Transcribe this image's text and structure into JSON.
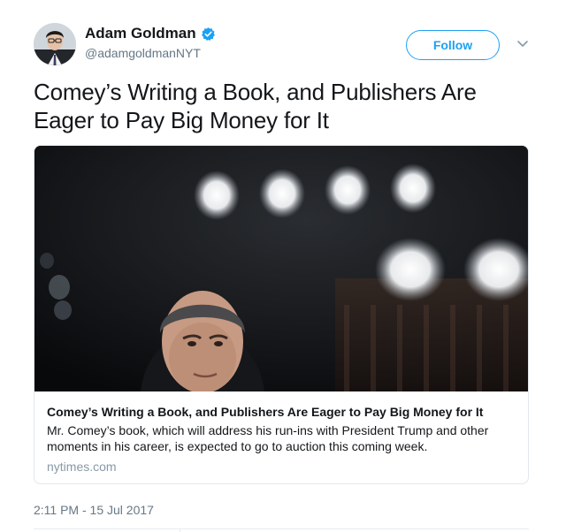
{
  "user": {
    "name": "Adam Goldman",
    "handle": "@adamgoldmanNYT",
    "verified": true,
    "avatar_icon": "person-portrait-avatar"
  },
  "actions": {
    "follow_label": "Follow",
    "menu_icon": "chevron-down-icon"
  },
  "tweet": {
    "text": "Comey’s Writing a Book, and Publishers Are Eager to Pay Big Money for It",
    "timestamp": "2:11 PM - 15 Jul 2017"
  },
  "card": {
    "title": "Comey’s Writing a Book, and Publishers Are Eager to Pay Big Money for It",
    "description": "Mr. Comey’s book, which will address his run-ins with President Trump and other moments in his career, is expected to go to auction this coming week.",
    "domain": "nytimes.com",
    "image_icon": "photo-hearing-room-portrait"
  },
  "colors": {
    "accent": "#1da1f2",
    "text": "#14171a",
    "secondary": "#657786",
    "border": "#e1e8ed"
  }
}
